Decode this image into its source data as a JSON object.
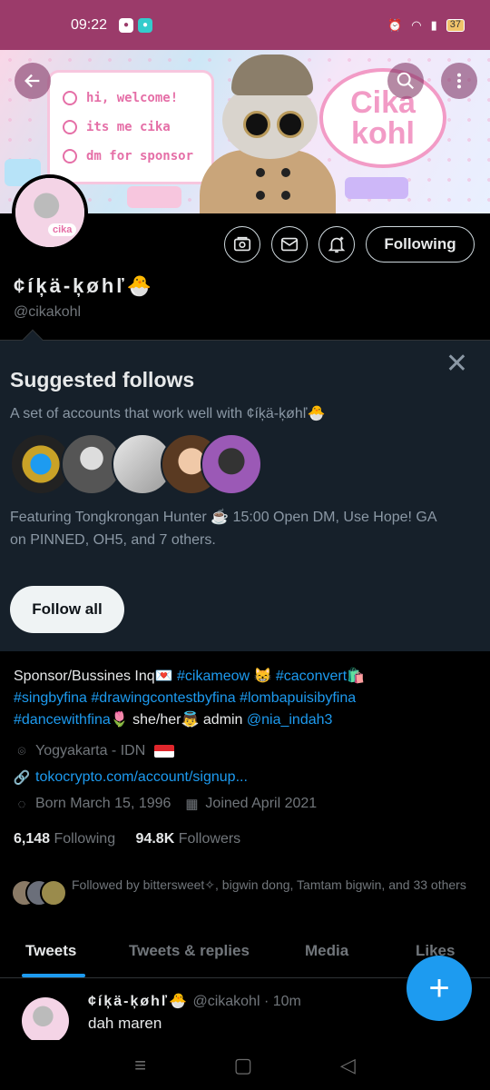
{
  "status_bar": {
    "time": "09:22",
    "battery": "37",
    "color_bg": "#9b3b6a"
  },
  "banner": {
    "card_lines": [
      "hi, welcome!",
      "its me cika",
      "dm for sponsor"
    ],
    "speech": "Cika kohl"
  },
  "header_buttons": {
    "back_icon": "arrow-left-icon",
    "search_icon": "search-icon",
    "more_icon": "more-vertical-icon"
  },
  "profile": {
    "name": "¢íķä-ķøhľ🐣",
    "handle": "@cikakohl",
    "follow_button": "Following",
    "avatar_label": "cika",
    "action_icons": [
      "subscribe-icon",
      "message-icon",
      "notification-bell-icon"
    ]
  },
  "suggested": {
    "title": "Suggested follows",
    "subtitle": "A set of accounts that work well with ¢íķä-ķøhľ🐣",
    "featuring": "Featuring Tongkrongan Hunter ☕ 15:00 Open DM, Use Hope! GA on PINNED, OH5, and 7 others.",
    "follow_all": "Follow all"
  },
  "bio": {
    "text_1": "Sponsor/Bussines Inq💌 ",
    "tag_1": "#cikameow",
    "emoji_1": "😸 ",
    "tag_2": "#caconvert",
    "emoji_2": "🛍️ ",
    "tag_3": "#singbyfina",
    "tag_4": "#drawingcontestbyfina",
    "tag_5": "#lombapuisibyfina",
    "tag_6": "#dancewithfina",
    "text_2": "🌷 she/her👼 admin ",
    "mention": "@nia_indah3",
    "location": "Yogyakarta - IDN",
    "website": "tokocrypto.com/account/signup...",
    "born": "Born March 15, 1996",
    "joined": "Joined April 2021"
  },
  "counts": {
    "following_num": "6,148",
    "following_label": "Following",
    "followers_num": "94.8K",
    "followers_label": "Followers"
  },
  "followed_by": "Followed by bittersweet✧, bigwin dong, Tamtam bigwin, and 33 others",
  "tabs": [
    "Tweets",
    "Tweets & replies",
    "Media",
    "Likes"
  ],
  "tweet": {
    "name": "¢íķä-ķøhľ🐣",
    "meta": " @cikakohl · 10m",
    "text": "dah maren"
  },
  "fab_label": "+",
  "nav": [
    "≡",
    "▢",
    "◁"
  ],
  "colors": {
    "accent": "#1d9bf0",
    "suggest_bg": "#16202a"
  }
}
